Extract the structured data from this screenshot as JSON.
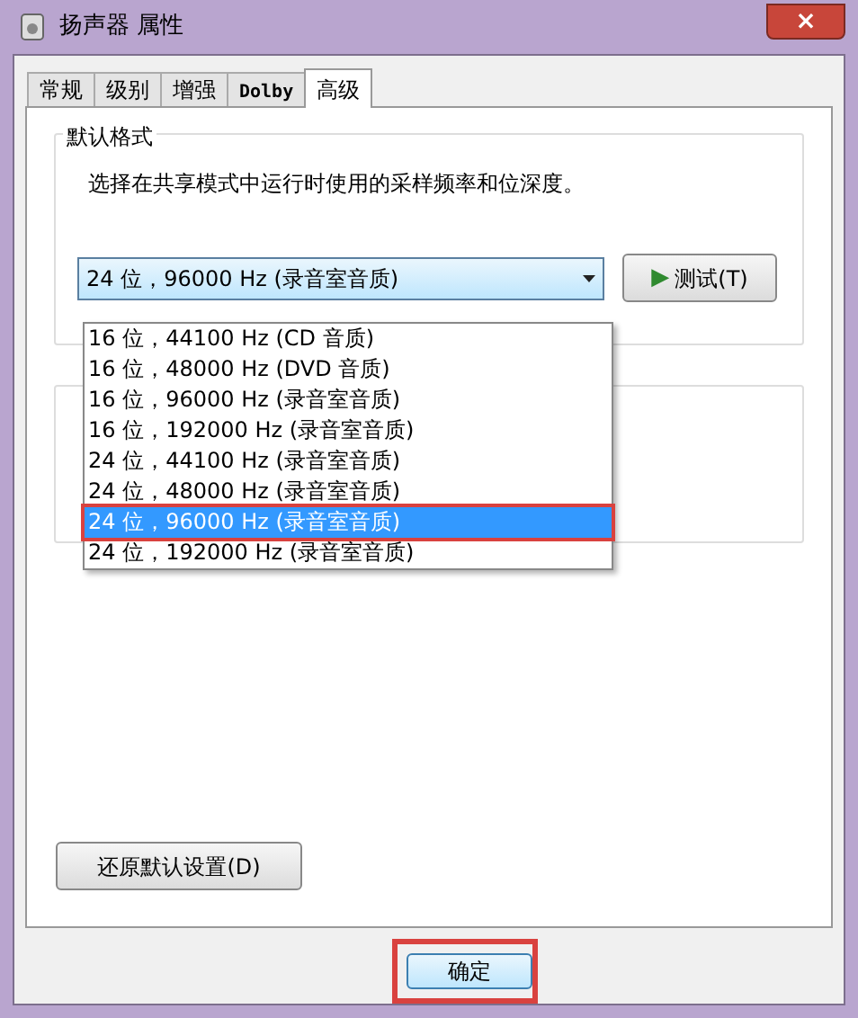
{
  "window": {
    "title": "扬声器 属性",
    "close": "×"
  },
  "tabs": [
    {
      "label": "常规",
      "selected": false
    },
    {
      "label": "级别",
      "selected": false
    },
    {
      "label": "增强",
      "selected": false
    },
    {
      "label": "Dolby",
      "selected": false
    },
    {
      "label": "高级",
      "selected": true
    }
  ],
  "default_format": {
    "title": "默认格式",
    "description": "选择在共享模式中运行时使用的采样频率和位深度。",
    "value": "24 位，96000 Hz (录音室音质)",
    "test_button": "测试(T)",
    "test_icon": "▶",
    "options": [
      {
        "label": "16 位，44100 Hz (CD 音质)",
        "selected": false,
        "annotated": false
      },
      {
        "label": "16 位，48000 Hz (DVD 音质)",
        "selected": false,
        "annotated": false
      },
      {
        "label": "16 位，96000 Hz (录音室音质)",
        "selected": false,
        "annotated": false
      },
      {
        "label": "16 位，192000 Hz (录音室音质)",
        "selected": false,
        "annotated": false
      },
      {
        "label": "24 位，44100 Hz (录音室音质)",
        "selected": false,
        "annotated": false
      },
      {
        "label": "24 位，48000 Hz (录音室音质)",
        "selected": false,
        "annotated": false
      },
      {
        "label": "24 位，96000 Hz (录音室音质)",
        "selected": true,
        "annotated": true
      },
      {
        "label": "24 位，192000 Hz (录音室音质)",
        "selected": false,
        "annotated": false
      }
    ]
  },
  "restore_button": "还原默认设置(D)",
  "buttons": [
    {
      "label": "确定",
      "annotated": true
    }
  ]
}
